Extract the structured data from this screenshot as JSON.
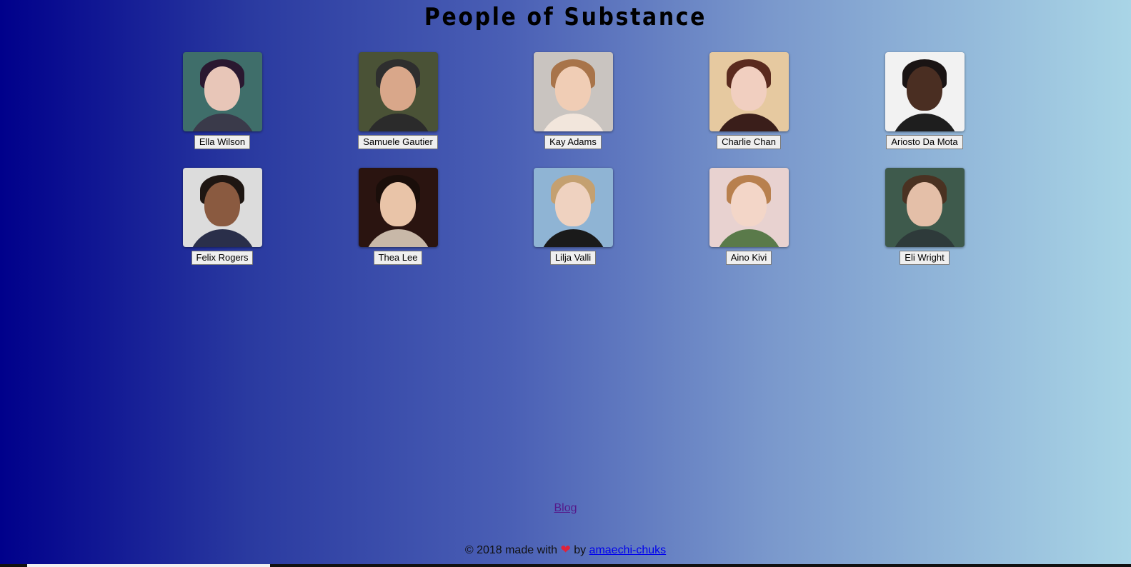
{
  "header": {
    "title": "People of Substance"
  },
  "people": [
    {
      "name": "Ella Wilson",
      "bg": "#3f6e6a",
      "skin": "#e8c6b8",
      "hair": "#2a1830",
      "shirt": "#3a3a4a"
    },
    {
      "name": "Samuele Gautier",
      "bg": "#4a5236",
      "skin": "#d9a78a",
      "hair": "#2e2e2e",
      "shirt": "#2b2b2b"
    },
    {
      "name": "Kay Adams",
      "bg": "#c9c4c0",
      "skin": "#f0cdb5",
      "hair": "#a8744a",
      "shirt": "#f2e6dc"
    },
    {
      "name": "Charlie Chan",
      "bg": "#e6c9a0",
      "skin": "#f1cfc0",
      "hair": "#5a2a1e",
      "shirt": "#3a1e1a"
    },
    {
      "name": "Ariosto Da Mota",
      "bg": "#f2f2f2",
      "skin": "#4a2e22",
      "hair": "#1a1414",
      "shirt": "#1e1e1e"
    },
    {
      "name": "Felix Rogers",
      "bg": "#dcdcdc",
      "skin": "#8a5a40",
      "hair": "#1e1612",
      "shirt": "#2a2f4a"
    },
    {
      "name": "Thea Lee",
      "bg": "#2a1410",
      "skin": "#e9c4a8",
      "hair": "#1a0e0a",
      "shirt": "#c8b8a8"
    },
    {
      "name": "Lilja Valli",
      "bg": "#8fb4d4",
      "skin": "#efd2c0",
      "hair": "#c4a070",
      "shirt": "#1a1a1a"
    },
    {
      "name": "Aino Kivi",
      "bg": "#e8d2d0",
      "skin": "#f3d6c8",
      "hair": "#b8804e",
      "shirt": "#5a7a4a"
    },
    {
      "name": "Eli Wright",
      "bg": "#3e5a4c",
      "skin": "#e4bfa8",
      "hair": "#4a3222",
      "shirt": "#2e3a3a"
    }
  ],
  "blog": {
    "label": "Blog"
  },
  "footer": {
    "prefix": "© 2018 made with",
    "heart_icon": "heart-icon",
    "by": "by",
    "author_link": "amaechi-chuks"
  },
  "colors": {
    "gradient_start": "#00008b",
    "gradient_end": "#a9d5e6",
    "heart": "#e0223a"
  }
}
